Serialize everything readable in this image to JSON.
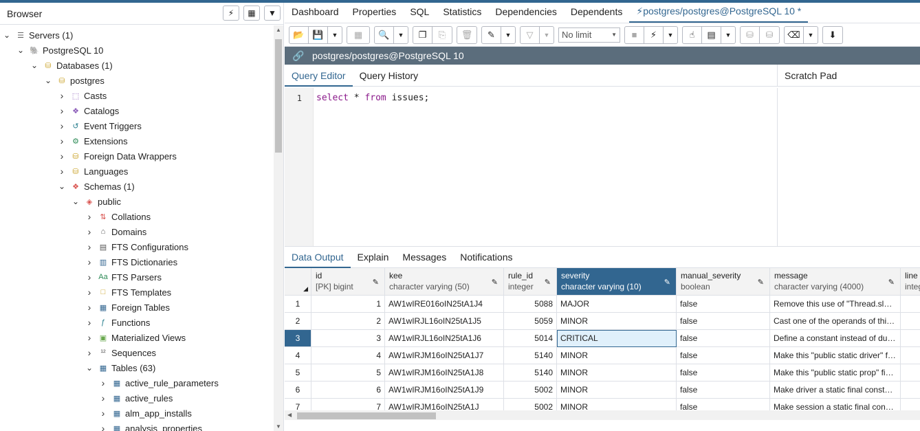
{
  "browser": {
    "title": "Browser",
    "tree": [
      {
        "label": "Servers (1)",
        "icon": "servers-icon",
        "level": 0,
        "expanded": true
      },
      {
        "label": "PostgreSQL 10",
        "icon": "elephant-icon",
        "level": 1,
        "expanded": true
      },
      {
        "label": "Databases (1)",
        "icon": "databases-icon",
        "level": 2,
        "expanded": true
      },
      {
        "label": "postgres",
        "icon": "database-icon",
        "level": 3,
        "expanded": true
      },
      {
        "label": "Casts",
        "icon": "casts-icon",
        "level": 4,
        "expanded": false
      },
      {
        "label": "Catalogs",
        "icon": "catalogs-icon",
        "level": 4,
        "expanded": false
      },
      {
        "label": "Event Triggers",
        "icon": "event-triggers-icon",
        "level": 4,
        "expanded": false
      },
      {
        "label": "Extensions",
        "icon": "extensions-icon",
        "level": 4,
        "expanded": false
      },
      {
        "label": "Foreign Data Wrappers",
        "icon": "fdw-icon",
        "level": 4,
        "expanded": false
      },
      {
        "label": "Languages",
        "icon": "languages-icon",
        "level": 4,
        "expanded": false
      },
      {
        "label": "Schemas (1)",
        "icon": "schemas-icon",
        "level": 4,
        "expanded": true
      },
      {
        "label": "public",
        "icon": "schema-icon",
        "level": 5,
        "expanded": true
      },
      {
        "label": "Collations",
        "icon": "collations-icon",
        "level": 6,
        "expanded": false
      },
      {
        "label": "Domains",
        "icon": "domains-icon",
        "level": 6,
        "expanded": false
      },
      {
        "label": "FTS Configurations",
        "icon": "fts-config-icon",
        "level": 6,
        "expanded": false
      },
      {
        "label": "FTS Dictionaries",
        "icon": "fts-dict-icon",
        "level": 6,
        "expanded": false
      },
      {
        "label": "FTS Parsers",
        "icon": "fts-parser-icon",
        "level": 6,
        "expanded": false
      },
      {
        "label": "FTS Templates",
        "icon": "fts-template-icon",
        "level": 6,
        "expanded": false
      },
      {
        "label": "Foreign Tables",
        "icon": "foreign-table-icon",
        "level": 6,
        "expanded": false
      },
      {
        "label": "Functions",
        "icon": "function-icon",
        "level": 6,
        "expanded": false
      },
      {
        "label": "Materialized Views",
        "icon": "matview-icon",
        "level": 6,
        "expanded": false
      },
      {
        "label": "Sequences",
        "icon": "sequence-icon",
        "level": 6,
        "expanded": false
      },
      {
        "label": "Tables (63)",
        "icon": "tables-icon",
        "level": 6,
        "expanded": true
      },
      {
        "label": "active_rule_parameters",
        "icon": "table-icon",
        "level": 7,
        "expanded": false
      },
      {
        "label": "active_rules",
        "icon": "table-icon",
        "level": 7,
        "expanded": false
      },
      {
        "label": "alm_app_installs",
        "icon": "table-icon",
        "level": 7,
        "expanded": false
      },
      {
        "label": "analysis_properties",
        "icon": "table-icon",
        "level": 7,
        "expanded": false
      }
    ]
  },
  "tabs": [
    {
      "label": "Dashboard"
    },
    {
      "label": "Properties"
    },
    {
      "label": "SQL"
    },
    {
      "label": "Statistics"
    },
    {
      "label": "Dependencies"
    },
    {
      "label": "Dependents"
    },
    {
      "label": "postgres/postgres@PostgreSQL 10 *",
      "active": true
    }
  ],
  "toolbar": {
    "limit_value": "No limit"
  },
  "connection": {
    "label": "postgres/postgres@PostgreSQL 10"
  },
  "editor_tabs": [
    {
      "label": "Query Editor",
      "active": true
    },
    {
      "label": "Query History"
    }
  ],
  "scratch_pad": {
    "label": "Scratch Pad"
  },
  "editor": {
    "line_number": "1",
    "kw_select": "select",
    "star": " * ",
    "kw_from": "from",
    "rest": " issues;"
  },
  "output_tabs": [
    {
      "label": "Data Output",
      "active": true
    },
    {
      "label": "Explain"
    },
    {
      "label": "Messages"
    },
    {
      "label": "Notifications"
    }
  ],
  "grid": {
    "columns": [
      {
        "name": "id",
        "type": "[PK] bigint"
      },
      {
        "name": "kee",
        "type": "character varying (50)"
      },
      {
        "name": "rule_id",
        "type": "integer"
      },
      {
        "name": "severity",
        "type": "character varying (10)",
        "selected": true
      },
      {
        "name": "manual_severity",
        "type": "boolean"
      },
      {
        "name": "message",
        "type": "character varying (4000)"
      },
      {
        "name": "line",
        "type": "integ"
      }
    ],
    "rows": [
      {
        "rn": "1",
        "id": "1",
        "kee": "AW1wIRE016oIN25tA1J4",
        "rule_id": "5088",
        "severity": "MAJOR",
        "manual_severity": "false",
        "message": "Remove this use of \"Thread.sleep()\"."
      },
      {
        "rn": "2",
        "id": "2",
        "kee": "AW1wIRJL16oIN25tA1J5",
        "rule_id": "5059",
        "severity": "MINOR",
        "manual_severity": "false",
        "message": "Cast one of the operands of this multiplication"
      },
      {
        "rn": "3",
        "id": "3",
        "kee": "AW1wIRJL16oIN25tA1J6",
        "rule_id": "5014",
        "severity": "CRITICAL",
        "manual_severity": "false",
        "message": "Define a constant instead of duplicating this literal"
      },
      {
        "rn": "4",
        "id": "4",
        "kee": "AW1wIRJM16oIN25tA1J7",
        "rule_id": "5140",
        "severity": "MINOR",
        "manual_severity": "false",
        "message": "Make this \"public static driver\" field final"
      },
      {
        "rn": "5",
        "id": "5",
        "kee": "AW1wIRJM16oIN25tA1J8",
        "rule_id": "5140",
        "severity": "MINOR",
        "manual_severity": "false",
        "message": "Make this \"public static prop\" field final"
      },
      {
        "rn": "6",
        "id": "6",
        "kee": "AW1wIRJM16oIN25tA1J9",
        "rule_id": "5002",
        "severity": "MINOR",
        "manual_severity": "false",
        "message": "Make driver a static final constant or non-static"
      },
      {
        "rn": "7",
        "id": "7",
        "kee": "AW1wIRJM16oIN25tA1J",
        "rule_id": "5002",
        "severity": "MINOR",
        "manual_severity": "false",
        "message": "Make session a static final constant or non-static"
      }
    ],
    "selected_row": "3"
  },
  "colors": {
    "accent": "#326690",
    "connbar": "#5b6d7c",
    "selected_cell": "#e0f0fb"
  }
}
